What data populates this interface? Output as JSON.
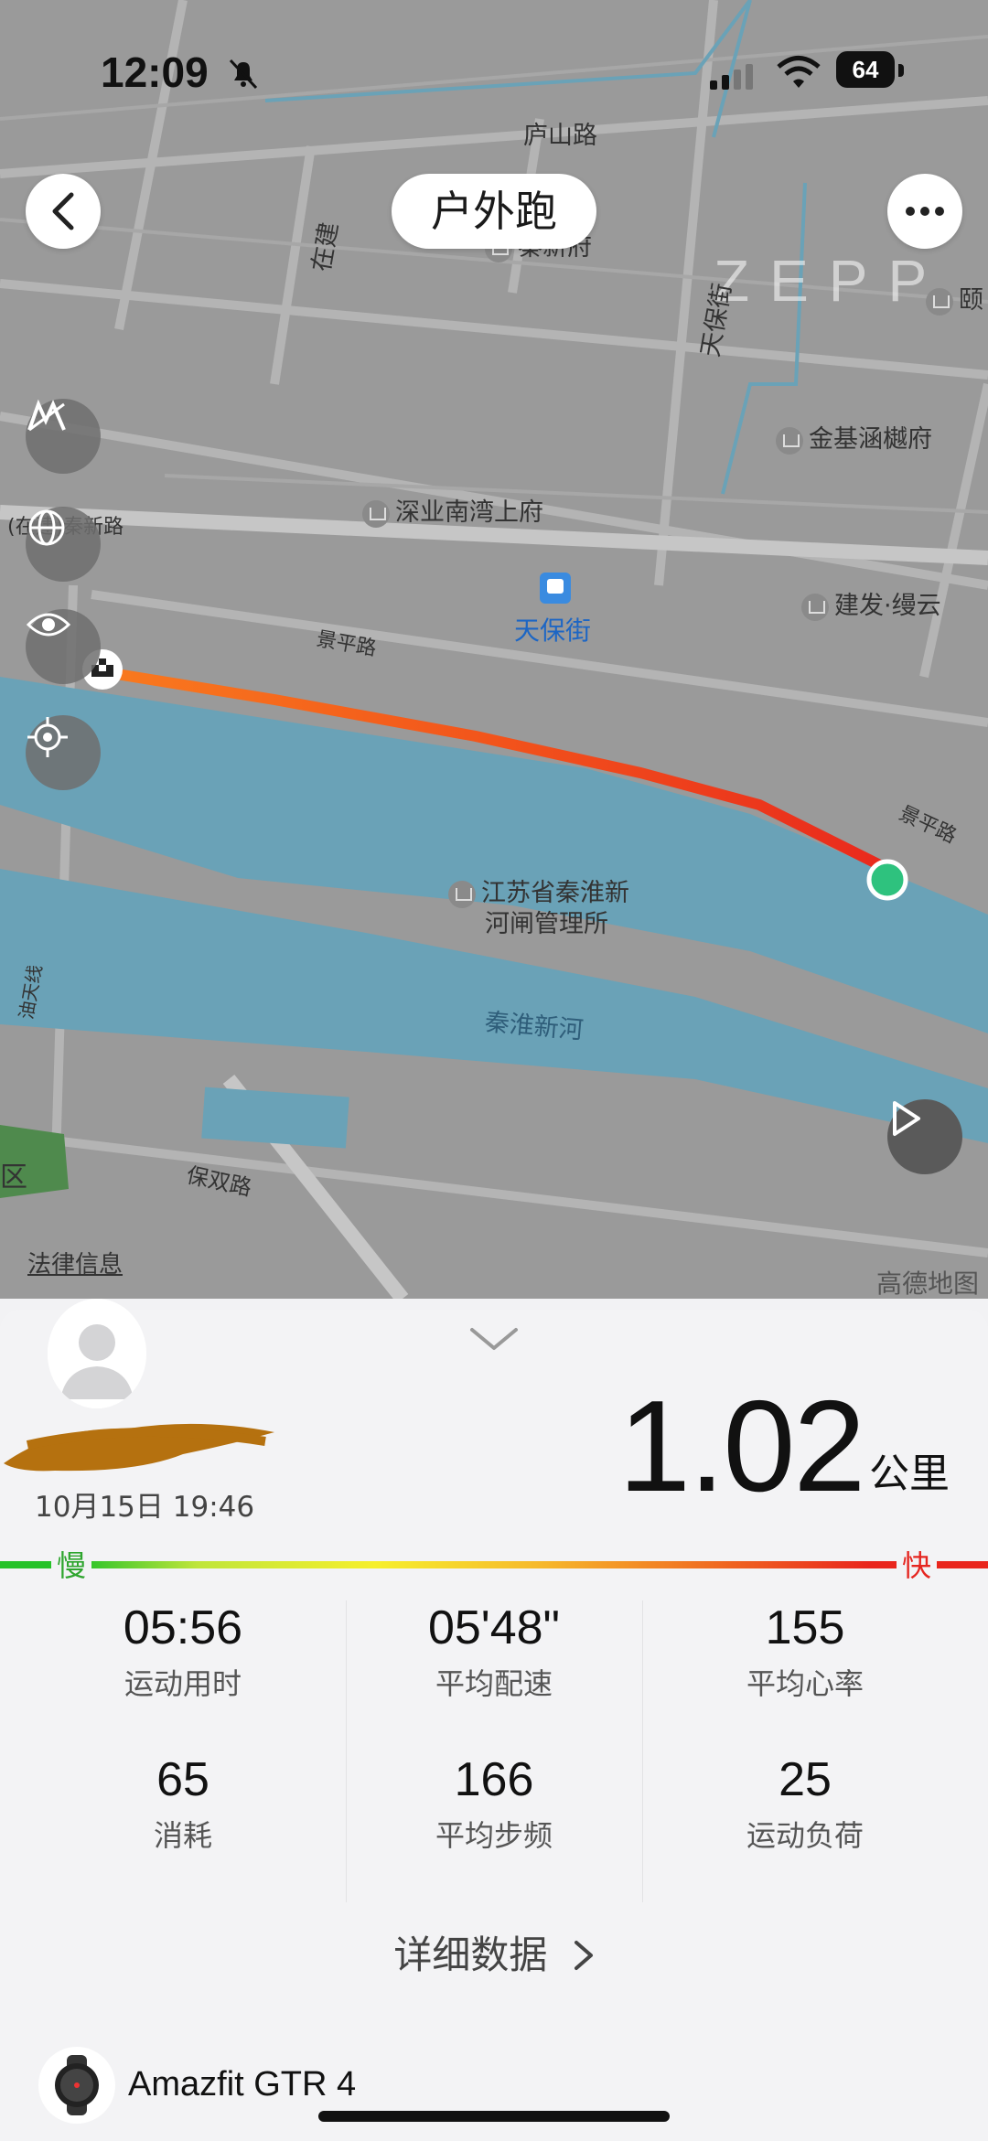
{
  "status_bar": {
    "time": "12:09",
    "battery": "64"
  },
  "header": {
    "title": "户外跑",
    "back_icon": "chevron-left-icon",
    "more_icon": "ellipsis-icon"
  },
  "map": {
    "watermark": "ZEPP",
    "labels": {
      "lushan_road": "庐山路",
      "zaijian": "在建",
      "qinxin_fu": "秦新府",
      "tianbao_street": "天保街",
      "jinji_hanyufu": "金基涵樾府",
      "xi": "颐",
      "shenye_nanwan": "深业南湾上府",
      "zaijian_qinxin_road": "(在建)秦新路",
      "tianbaojie_station": "天保街",
      "jianfa_yunyun": "建发·缦云",
      "jingping_road": "景平路",
      "jingping_road_2": "景平路",
      "jiangsu_qinhuai": "江苏省秦淮新",
      "hezha_suo": "河闸管理所",
      "qinhuai_xinhe": "秦淮新河",
      "youtian_line": "油天线",
      "baoshuang_road": "保双路",
      "district": "区"
    },
    "legal_info": "法律信息",
    "map_provider": "高德地图"
  },
  "summary": {
    "date": "10月15日 19:46",
    "distance": "1.02",
    "distance_unit": "公里",
    "pace_slow": "慢",
    "pace_fast": "快"
  },
  "stats": [
    {
      "value": "05:56",
      "label": "运动用时"
    },
    {
      "value": "05'48\"",
      "label": "平均配速"
    },
    {
      "value": "155",
      "label": "平均心率"
    },
    {
      "value": "65",
      "label": "消耗"
    },
    {
      "value": "166",
      "label": "平均步频"
    },
    {
      "value": "25",
      "label": "运动负荷"
    }
  ],
  "detail_link": "详细数据",
  "device": {
    "name": "Amazfit GTR 4"
  },
  "colors": {
    "route_start": "#f97a1e",
    "route_end": "#e92a1d",
    "end_marker": "#2ec27e",
    "water": "#6aa2b7"
  }
}
